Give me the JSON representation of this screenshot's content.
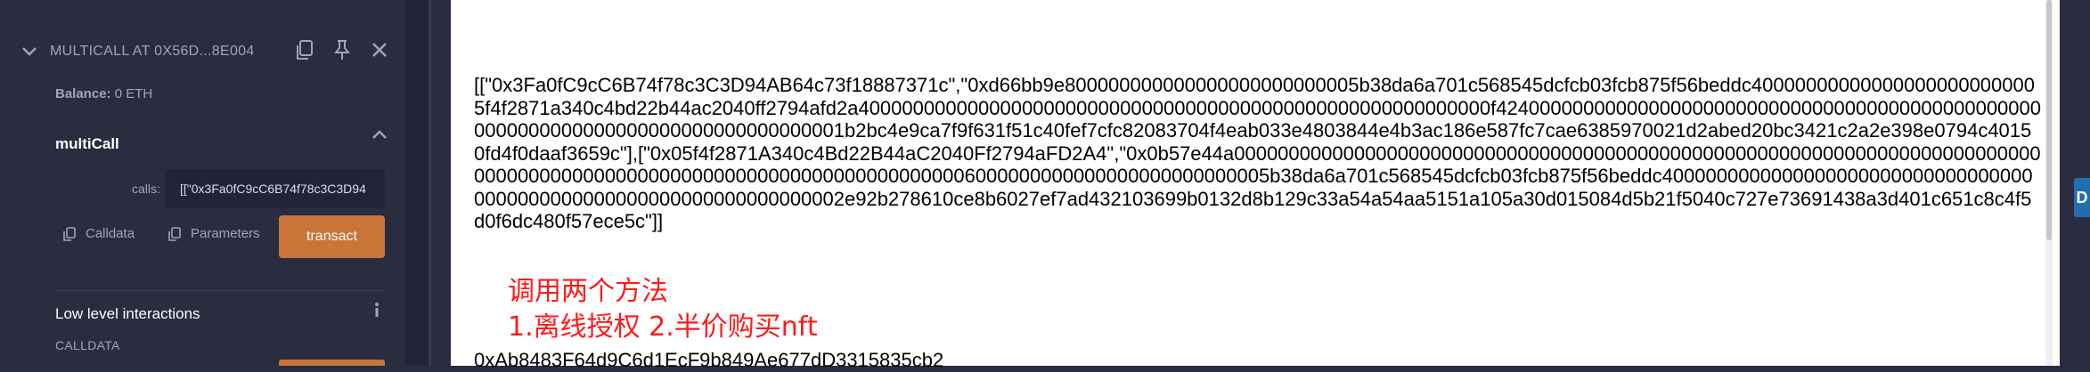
{
  "instance": {
    "title": "MULTICALL AT 0X56D...8E004"
  },
  "balance": {
    "label": "Balance:",
    "value": "0 ETH"
  },
  "function": {
    "name": "multiCall",
    "param_label": "calls:",
    "param_value": "[[\"0x3Fa0fC9cC6B74f78c3C3D94",
    "calldata_label": "Calldata",
    "parameters_label": "Parameters",
    "transact_label": "transact"
  },
  "low_level": {
    "title": "Low level interactions",
    "calldata_label": "CALLDATA"
  },
  "output": {
    "text": "[[\"0x3Fa0fC9cC6B74f78c3C3D94AB64c73f18887371c\",\"0xd66bb9e800000000000000000000000005b38da6a701c568545dcfcb03fcb875f56beddc400000000000000000000000005f4f2871a340c4bd22b44ac2040ff2794afd2a4000000000000000000000000000000000000000000000000000000000f424000000000000000000000000000000000000000000000000000000000000000000000000000000001b2bc4e9ca7f9f631f51c40fef7cfc82083704f4eab033e4803844e4b3ac186e587fc7cae6385970021d2abed20bc3421c2a2e398e0794c40150fd4f0daaf3659c\"],[\"0x05f4f2871A340c4Bd22B44aC2040Ff2794aFD2A4\",\"0x0b57e44a000000000000000000000000000000000000000000000000000000000000000000000000000000000000000000000000000000000000000000000006000000000000000000000000005b38da6a701c568545dcfcb03fcb875f56beddc40000000000000000000000000000000000000000000000000000000000000000002e92b278610ce8b6027ef7ad432103699b0132d8b129c33a54a54aa5151a105a30d015084d5b21f5040c727e73691438a3d401c651c8c4f5d0f6dc480f57ece5c\"]]"
  },
  "note": {
    "line1": "调用两个方法",
    "line2": "1.离线授权 2.半价购买nft"
  },
  "address_line": "0xAb8483F64d9C6d1EcF9b849Ae677dD3315835cb2",
  "edge_tab": "D",
  "icons": [
    "chevron-down-icon",
    "copy-icon",
    "pin-icon",
    "close-icon",
    "chevron-up-icon",
    "info-icon"
  ],
  "colors": {
    "panel_bg": "#2a2c3f",
    "accent_orange": "#c97539",
    "note_red": "#ff1a1a"
  }
}
